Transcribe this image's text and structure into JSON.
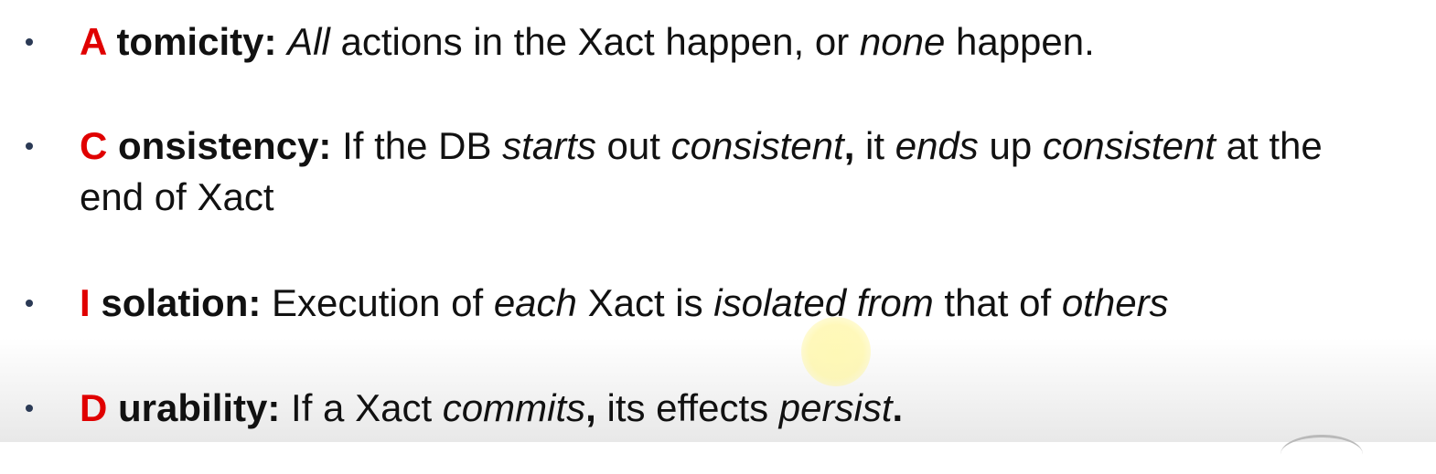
{
  "items": [
    {
      "letter": "A",
      "term": " tomicity:",
      "parts": [
        " ",
        "All",
        " actions in the Xact happen, or ",
        "none",
        " happen."
      ]
    },
    {
      "letter": "C",
      "term": " onsistency:",
      "parts": [
        " If the DB ",
        "starts",
        " out ",
        "consistent",
        ",",
        " it ",
        "ends",
        " up ",
        "consistent",
        " at the end of Xact"
      ]
    },
    {
      "letter": "I",
      "term": " solation:",
      "parts": [
        " Execution of ",
        "each",
        " Xact is ",
        "isolated from",
        " that of ",
        "others"
      ]
    },
    {
      "letter": "D",
      "term": " urability:",
      "parts": [
        " If a Xact ",
        "commits",
        ",",
        " its effects ",
        "persist",
        "."
      ]
    }
  ],
  "colors": {
    "letter": "#e00000",
    "text": "#111111",
    "bullet": "#2b3a55",
    "cursor_highlight": "#fff5a0"
  }
}
